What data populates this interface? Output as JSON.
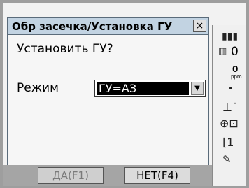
{
  "dialog": {
    "title": "Обр засечка/Установка ГУ",
    "close_label": "×",
    "prompt": "Установить ГУ?",
    "mode_label": "Режим",
    "mode_value": "ГУ=АЗ"
  },
  "softkeys": {
    "yes": "ДА(F1)",
    "no": "НЕТ(F4)"
  },
  "status_panel": {
    "battery": "▮▮▮",
    "prism_const": "0",
    "ppm_value": "0",
    "ppm_label": "ppm"
  }
}
